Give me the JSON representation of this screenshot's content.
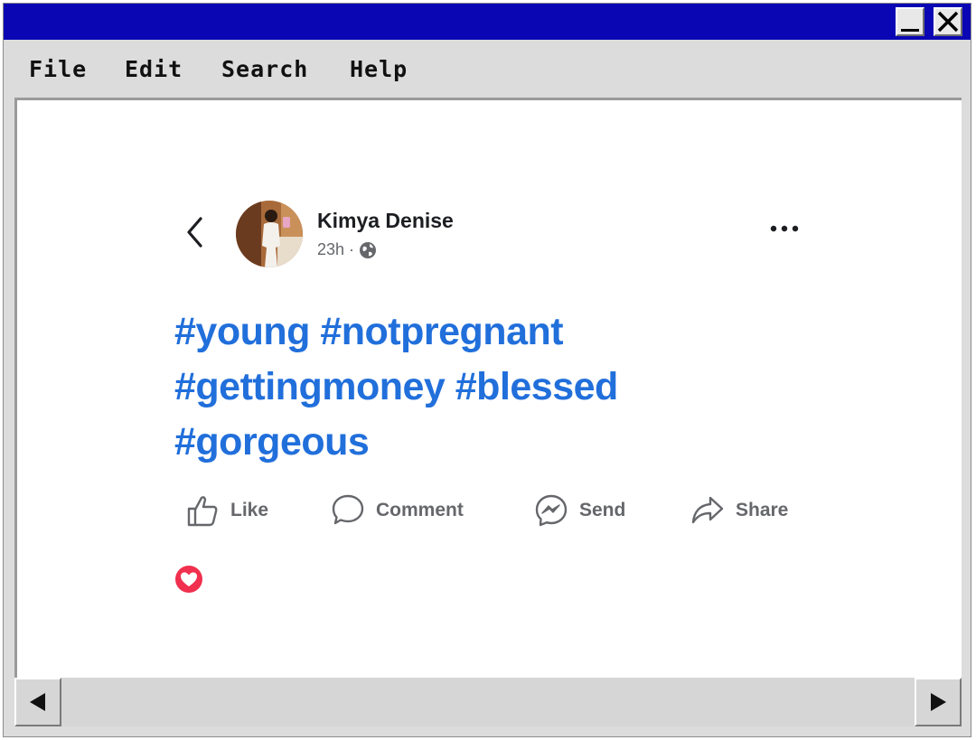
{
  "window": {
    "controls": {
      "minimize_icon": "minimize-icon",
      "close_icon": "close-icon"
    }
  },
  "menu": {
    "items": [
      {
        "label": "File"
      },
      {
        "label": "Edit"
      },
      {
        "label": "Search"
      },
      {
        "label": "Help"
      }
    ]
  },
  "post": {
    "author": "Kimya Denise",
    "time": "23h",
    "separator": "·",
    "privacy_icon": "globe-icon",
    "hashtags": [
      "#young",
      "#notpregnant",
      "#gettingmoney",
      "#blessed",
      "#gorgeous"
    ],
    "actions": [
      {
        "label": "Like",
        "icon": "thumbs-up-icon"
      },
      {
        "label": "Comment",
        "icon": "comment-bubble-icon"
      },
      {
        "label": "Send",
        "icon": "messenger-icon"
      },
      {
        "label": "Share",
        "icon": "share-arrow-icon"
      }
    ],
    "reactions": [
      {
        "icon": "love-reaction-icon"
      }
    ]
  },
  "colors": {
    "titlebar": "#0a06b4",
    "hashtag": "#216fdb",
    "muted_text": "#65676b",
    "love_reaction": "#f0304e"
  }
}
